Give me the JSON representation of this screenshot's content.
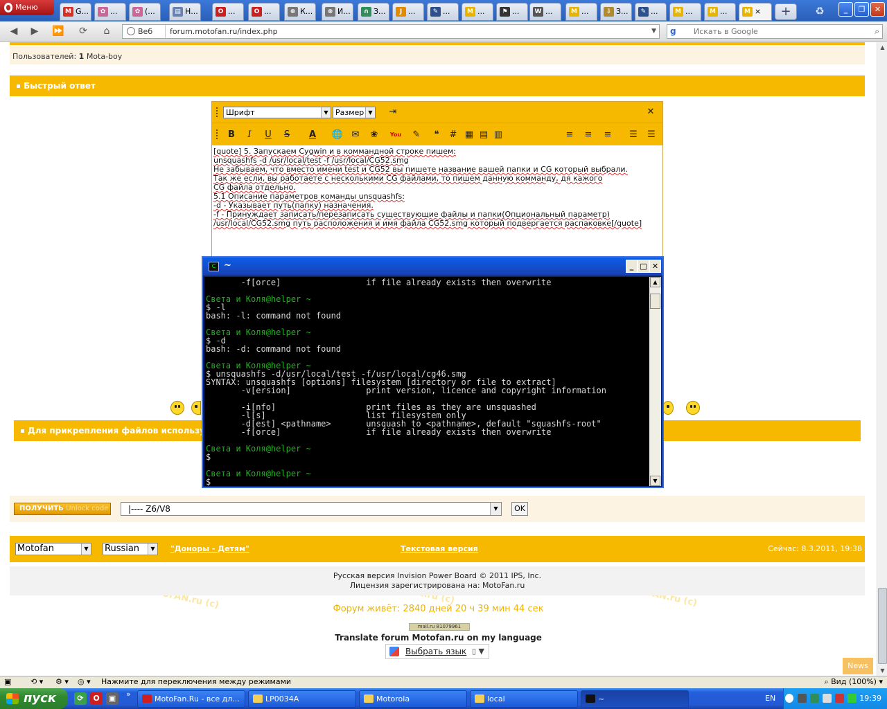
{
  "browser": {
    "menu_label": "Меню",
    "tabs": [
      {
        "label": "G...",
        "icon": "gmail-icon",
        "color": "#d93025",
        "glyph": "M"
      },
      {
        "label": "...",
        "icon": "colors-icon",
        "color": "#cc6699",
        "glyph": "✿"
      },
      {
        "label": "(...",
        "icon": "colors-icon",
        "color": "#cc6699",
        "glyph": "✿"
      },
      {
        "label": "Н...",
        "icon": "page-icon",
        "color": "#6a82b0",
        "glyph": "▤"
      },
      {
        "label": "...",
        "icon": "opera-icon",
        "color": "#cc1f1f",
        "glyph": "O"
      },
      {
        "label": "...",
        "icon": "opera-icon",
        "color": "#cc1f1f",
        "glyph": "O"
      },
      {
        "label": "К...",
        "icon": "reel-icon",
        "color": "#777777",
        "glyph": "⊛"
      },
      {
        "label": "И...",
        "icon": "reel-icon",
        "color": "#777777",
        "glyph": "⊛"
      },
      {
        "label": "З...",
        "icon": "headphones-icon",
        "color": "#2f8f5b",
        "glyph": "∩"
      },
      {
        "label": "...",
        "icon": "job-icon",
        "color": "#e38b00",
        "glyph": "J"
      },
      {
        "label": "...",
        "icon": "edit-icon",
        "color": "#2d4f8c",
        "glyph": "✎"
      },
      {
        "label": "...",
        "icon": "motofan-icon",
        "color": "#e8b400",
        "glyph": "M"
      },
      {
        "label": "...",
        "icon": "flag-icon",
        "color": "#333333",
        "glyph": "⚑"
      },
      {
        "label": "...",
        "icon": "wikipedia-icon",
        "color": "#555555",
        "glyph": "W"
      },
      {
        "label": "...",
        "icon": "motofan-icon",
        "color": "#e8b400",
        "glyph": "M"
      },
      {
        "label": "З...",
        "icon": "download-icon",
        "color": "#b08a2e",
        "glyph": "⇩"
      },
      {
        "label": "...",
        "icon": "edit-icon",
        "color": "#2d4f8c",
        "glyph": "✎"
      },
      {
        "label": "...",
        "icon": "motofan-icon",
        "color": "#e8b400",
        "glyph": "M"
      },
      {
        "label": "...",
        "icon": "motofan-icon",
        "color": "#e8b400",
        "glyph": "M"
      },
      {
        "label": "×",
        "icon": "motofan-icon",
        "color": "#e8b400",
        "glyph": "M"
      }
    ],
    "address": {
      "zone": "Веб",
      "url": "forum.motofan.ru/index.php"
    },
    "search": {
      "engine": "g",
      "placeholder": "Искать в Google"
    },
    "status": {
      "text": "Нажмите для переключения между режимами",
      "zoom": "Вид (100%)"
    }
  },
  "forum": {
    "users_label": "Пользователей:",
    "users_count": "1",
    "users_name": "Mota-boy",
    "quick_reply": "Быстрый ответ",
    "editor": {
      "font_select": "Шрифт",
      "size_select": "Размер",
      "text_lines": [
        "[quote] 5. Запускаем Cygwin и в коммандной строке пишем:",
        "unsquashfs -d /usr/local/test -f /usr/local/CG52.smg",
        "Не забываем, что вместо имени test и CG52 вы пишете название вашей папки и CG который выбрали.",
        "Так же если, вы работаете с несколькими CG файлами, то пишем данную комманду, дя кажого",
        "CG файла отдельно.",
        "5.1 Описание параметров команды unsquashfs:",
        "-d - Указывает путь(папку) назначения.",
        "-f - Принуждает записать/перезаписать существующие файлы и папки(Опциональный параметр)",
        "/usr/local/CG52.smg путь расположения и имя файла CG52.smg который подвергается распаковке[/quote]"
      ]
    },
    "attach_bar": "Для прикрепления файлов использу",
    "unlock": {
      "button_main": "ПОЛУЧИТЬ",
      "button_sub": "Unlock code",
      "selected": "|---- Z6/V8",
      "ok": "OK"
    },
    "footer": {
      "skin": "Motofan",
      "language": "Russian",
      "donors": "\"Доноры - Детям\"",
      "text_version": "Текстовая версия",
      "now": "Сейчас: 8.3.2011, 19:38",
      "copyright_1": "Русская версия Invision Power Board © 2011  IPS, Inc.",
      "copyright_2": "Лицензия зарегистрирована на: MotoFan.ru",
      "uptime": "Форум живёт: 2840 дней 20 ч 39 мин 44 сек",
      "counter": "mail.ru 81079961",
      "translate": "Translate forum Motofan.ru on my language",
      "choose_lang": "Выбрать язык",
      "news": "News",
      "watermark": "MOTOFAN.ru (c)"
    }
  },
  "terminal": {
    "title": "~",
    "lines": [
      {
        "t": "       -f[orce]                 if file already exists then overwrite",
        "c": ""
      },
      {
        "t": "",
        "c": ""
      },
      {
        "t": "Света и Коля@helper ~",
        "c": "g"
      },
      {
        "t": "$ -l",
        "c": ""
      },
      {
        "t": "bash: -l: command not found",
        "c": ""
      },
      {
        "t": "",
        "c": ""
      },
      {
        "t": "Света и Коля@helper ~",
        "c": "g"
      },
      {
        "t": "$ -d",
        "c": ""
      },
      {
        "t": "bash: -d: command not found",
        "c": ""
      },
      {
        "t": "",
        "c": ""
      },
      {
        "t": "Света и Коля@helper ~",
        "c": "g"
      },
      {
        "t": "$ unsquashfs -d/usr/local/test -f/usr/local/cg46.smg",
        "c": ""
      },
      {
        "t": "SYNTAX: unsquashfs [options] filesystem [directory or file to extract]",
        "c": ""
      },
      {
        "t": "       -v[ersion]               print version, licence and copyright information",
        "c": ""
      },
      {
        "t": "",
        "c": ""
      },
      {
        "t": "       -i[nfo]                  print files as they are unsquashed",
        "c": ""
      },
      {
        "t": "       -l[s]                    list filesystem only",
        "c": ""
      },
      {
        "t": "       -d[est] <pathname>       unsquash to <pathname>, default \"squashfs-root\"",
        "c": ""
      },
      {
        "t": "       -f[orce]                 if file already exists then overwrite",
        "c": ""
      },
      {
        "t": "",
        "c": ""
      },
      {
        "t": "Света и Коля@helper ~",
        "c": "g"
      },
      {
        "t": "$",
        "c": ""
      },
      {
        "t": "",
        "c": ""
      },
      {
        "t": "Света и Коля@helper ~",
        "c": "g"
      },
      {
        "t": "$",
        "c": ""
      }
    ]
  },
  "taskbar": {
    "start": "пуск",
    "tasks": [
      {
        "label": "MotoFan.Ru - все дл...",
        "icon": "opera-icon",
        "color": "#cc1f1f"
      },
      {
        "label": "LP0034A",
        "icon": "folder-icon",
        "color": "#f2cf5b"
      },
      {
        "label": "Motorola",
        "icon": "folder-icon",
        "color": "#f2cf5b"
      },
      {
        "label": "local",
        "icon": "folder-icon",
        "color": "#f2cf5b"
      },
      {
        "label": "~",
        "icon": "cygwin-icon",
        "color": "#111111"
      }
    ],
    "lang": "EN",
    "clock": "19:39"
  }
}
